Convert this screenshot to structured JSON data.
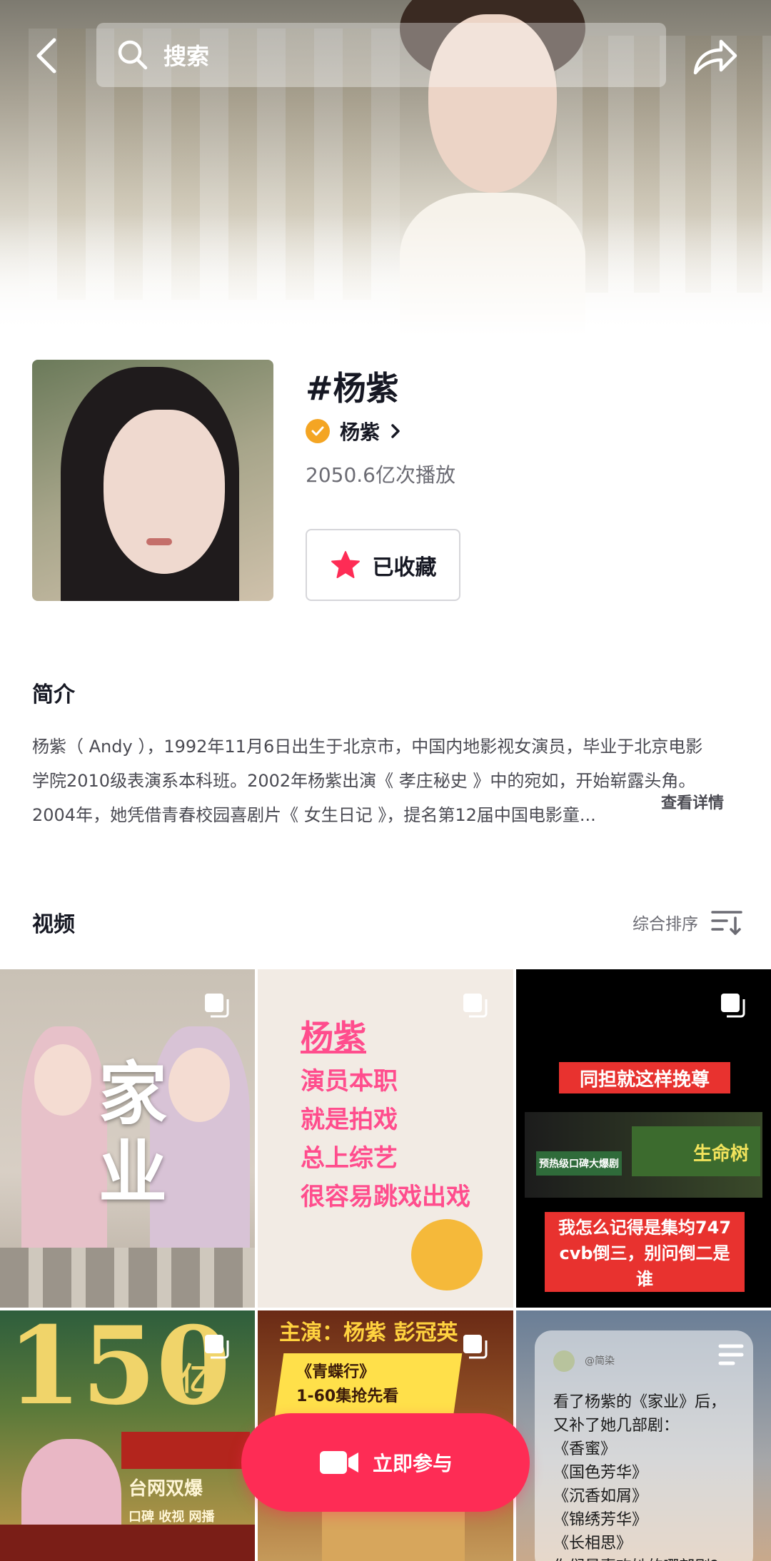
{
  "header": {
    "search_placeholder": "搜索"
  },
  "topic": {
    "title": "#杨紫",
    "author": "杨紫",
    "plays": "2050.6亿次播放",
    "favorite_label": "已收藏"
  },
  "intro": {
    "heading": "简介",
    "lines": [
      "杨紫（ Andy ），1992年11月6日出生于北京市，中国内地影视女演员，毕业于北京电影",
      "学院2010级表演系本科班。2002年杨紫出演《 孝庄秘史 》中的宛如，开始崭露头角。",
      "2004年，她凭借青春校园喜剧片《 女生日记 》，提名第12届中国电影童..."
    ],
    "more": "查看详情"
  },
  "videos": {
    "heading": "视频",
    "sort_label": "综合排序",
    "tiles": [
      {
        "big_text": "家业"
      },
      {
        "lines": [
          "杨紫",
          "演员本职",
          "就是拍戏",
          "总上综艺",
          "很容易跳戏出戏"
        ]
      },
      {
        "banner": "同担就这样挽尊",
        "green_label": "预热级口碑大爆剧",
        "sign": "生命树",
        "caption": [
          "我怎么记得是集均747",
          "cvb倒三，别问倒二是",
          "谁"
        ]
      },
      {
        "big_text": "150",
        "unit": "亿",
        "lines": [
          "台网双爆",
          "口碑 收视 网播"
        ]
      },
      {
        "caption": "主演：杨紫 彭冠英",
        "lines": [
          "《青蝶行》",
          "1-60集抢先看"
        ]
      },
      {
        "handle": "@简染",
        "lines": [
          "看了杨紫的《家业》后，",
          "又补了她几部剧：",
          "《香蜜》",
          "《国色芳华》",
          "《沉香如屑》",
          "《锦绣芳华》",
          "《长相思》",
          "你们最喜欢她的哪部剧?"
        ]
      }
    ]
  },
  "cta": {
    "label": "立即参与"
  },
  "colors": {
    "accent": "#fe2c55",
    "badge": "#f4a523"
  }
}
